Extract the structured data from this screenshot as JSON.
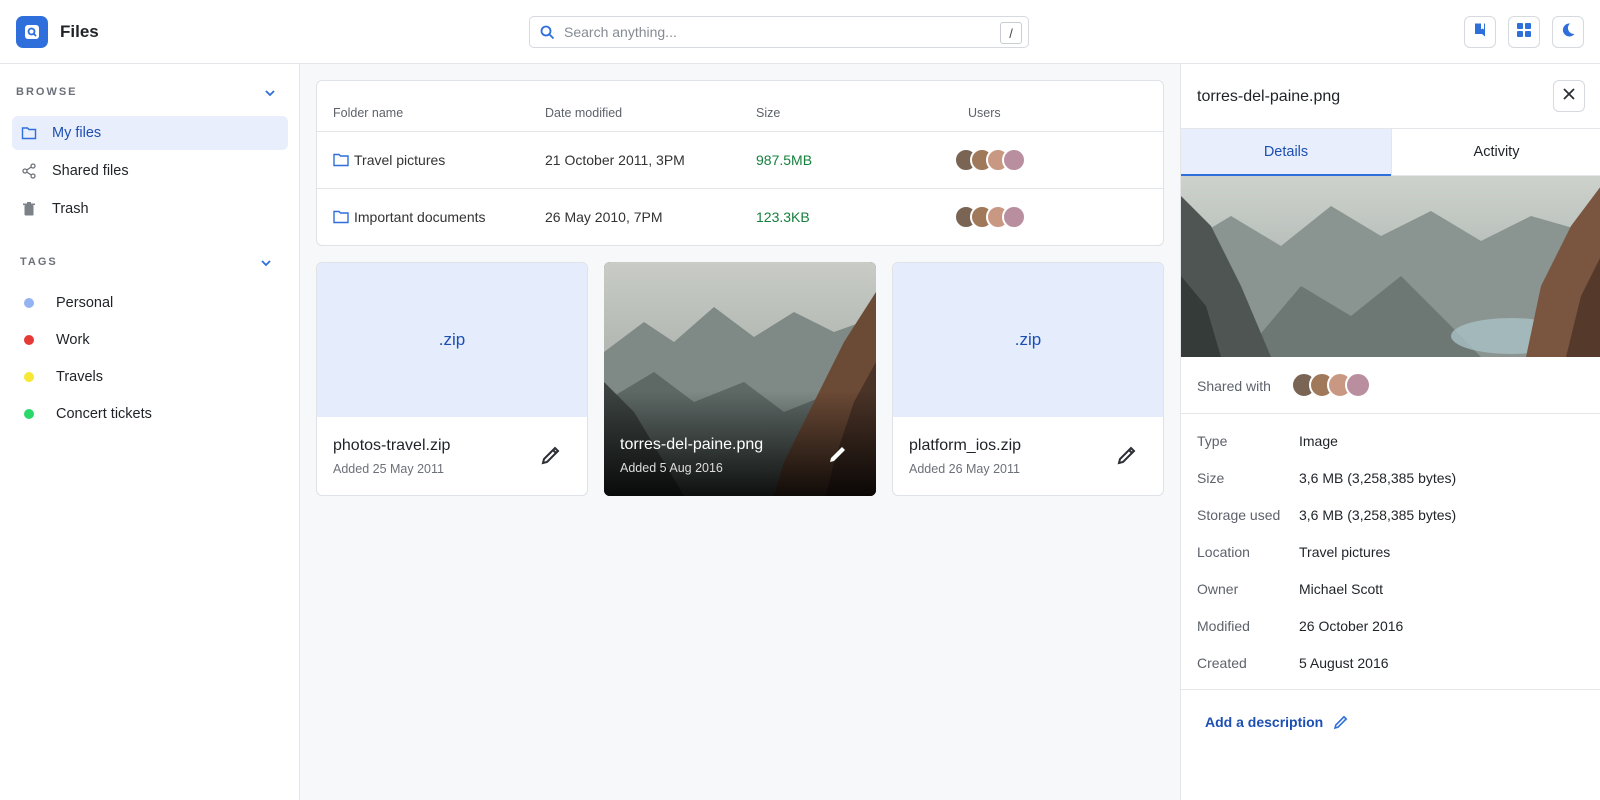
{
  "app": {
    "title": "Files"
  },
  "search": {
    "placeholder": "Search anything...",
    "shortcut": "/"
  },
  "sidebar": {
    "browse_heading": "BROWSE",
    "items": [
      {
        "label": "My files",
        "icon": "folder-icon",
        "active": true
      },
      {
        "label": "Shared files",
        "icon": "share-icon"
      },
      {
        "label": "Trash",
        "icon": "trash-icon"
      }
    ],
    "tags_heading": "TAGS",
    "tags": [
      {
        "label": "Personal",
        "color": "#93b4f0"
      },
      {
        "label": "Work",
        "color": "#e53935"
      },
      {
        "label": "Travels",
        "color": "#f7e836"
      },
      {
        "label": "Concert tickets",
        "color": "#2dd86b"
      }
    ]
  },
  "table": {
    "headers": [
      "Folder name",
      "Date modified",
      "Size",
      "Users"
    ],
    "rows": [
      {
        "name": "Travel pictures",
        "date": "21 October 2011, 3PM",
        "size": "987.5MB"
      },
      {
        "name": "Important documents",
        "date": "26 May 2010, 7PM",
        "size": "123.3KB"
      }
    ]
  },
  "cards": [
    {
      "thumb": ".zip",
      "name": "photos-travel.zip",
      "added": "Added 25 May 2011"
    },
    {
      "thumb": "",
      "name": "torres-del-paine.png",
      "added": "Added 5 Aug 2016"
    },
    {
      "thumb": ".zip",
      "name": "platform_ios.zip",
      "added": "Added 26 May 2011"
    }
  ],
  "panel": {
    "title": "torres-del-paine.png",
    "tabs": [
      "Details",
      "Activity"
    ],
    "shared_with": "Shared with",
    "details": [
      {
        "label": "Type",
        "value": "Image"
      },
      {
        "label": "Size",
        "value": "3,6 MB (3,258,385 bytes)"
      },
      {
        "label": "Storage used",
        "value": "3,6 MB (3,258,385 bytes)"
      },
      {
        "label": "Location",
        "value": "Travel pictures"
      },
      {
        "label": "Owner",
        "value": "Michael Scott"
      },
      {
        "label": "Modified",
        "value": "26 October 2016"
      },
      {
        "label": "Created",
        "value": "5 August 2016"
      }
    ],
    "add_description": "Add a description"
  },
  "colors": {
    "accent": "#2f6fdb",
    "accent_text": "#1d4fb3",
    "size_green": "#15803d"
  }
}
